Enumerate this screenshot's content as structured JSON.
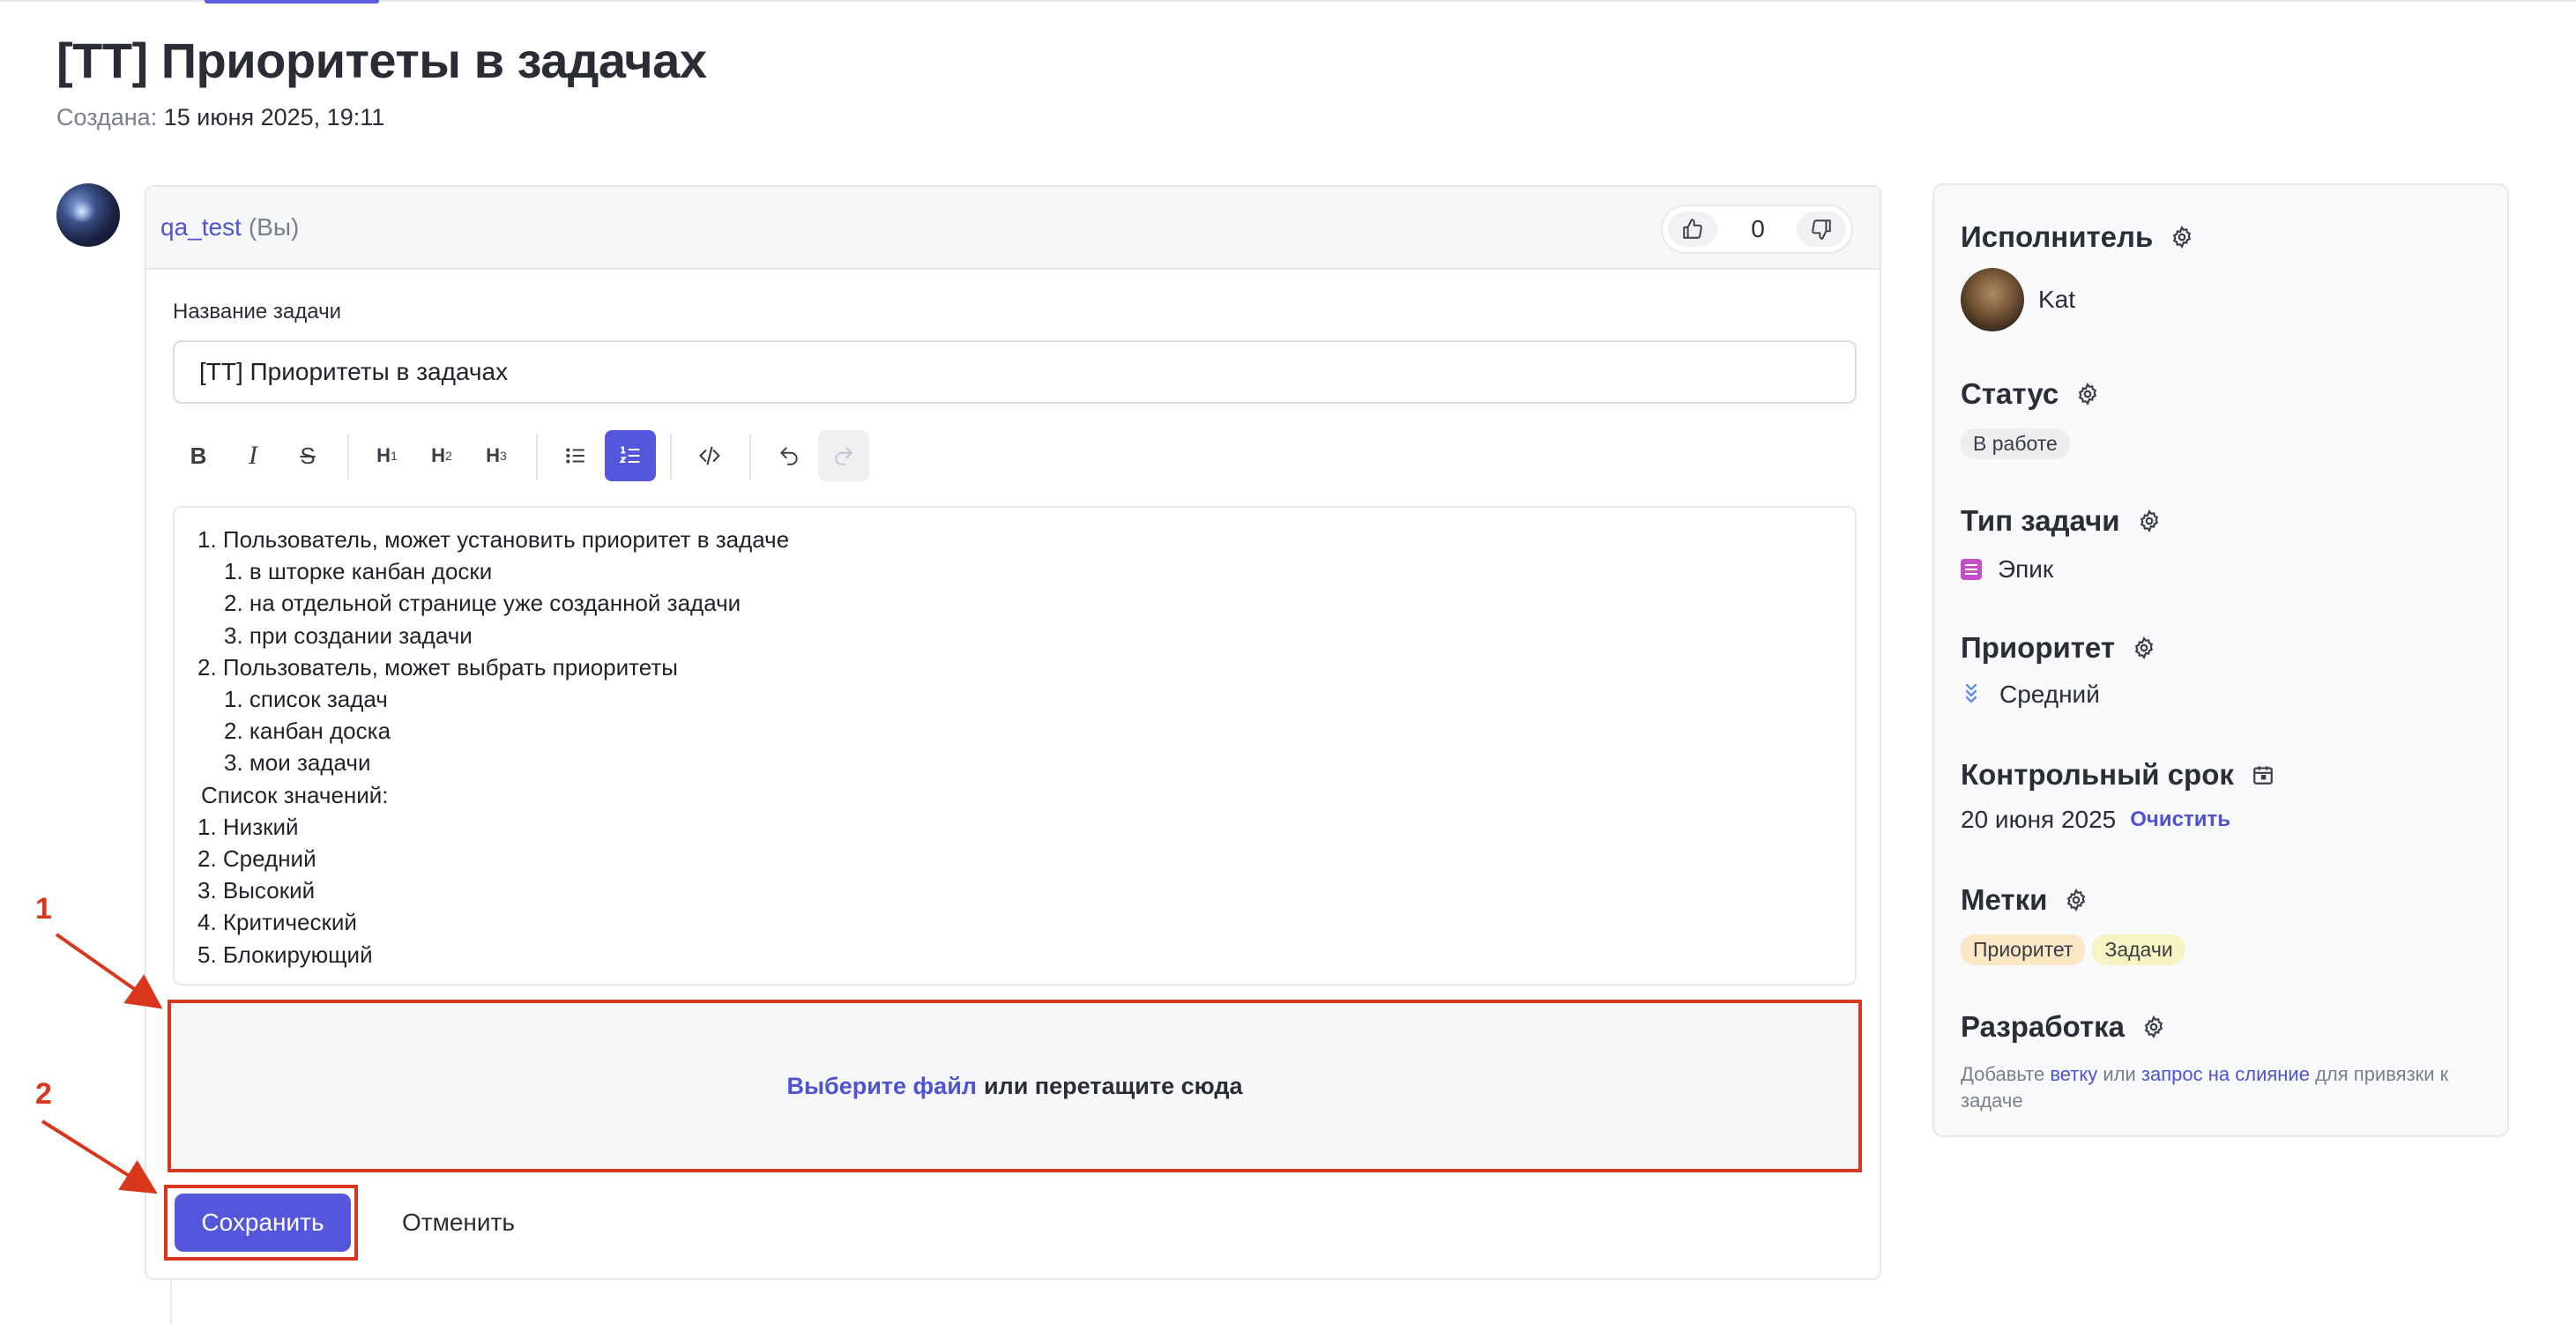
{
  "page": {
    "title": "[TT] Приоритеты в задачах",
    "created_label": "Создана:",
    "created_value": "15 июня 2025, 19:11"
  },
  "comment": {
    "author": "qa_test",
    "author_suffix": "(Вы)",
    "votes": 0
  },
  "form": {
    "title_label": "Название задачи",
    "title_value": "[TT] Приоритеты в задачах",
    "toolbar": {
      "bold": "B",
      "italic": "I",
      "strike": "S",
      "h1": "H",
      "h2": "H",
      "h3": "H",
      "h1_sub": "1",
      "h2_sub": "2",
      "h3_sub": "3",
      "active_tool": "ordered-list",
      "redo_disabled": true
    },
    "description": [
      "1. Пользователь, может установить приоритет в задаче",
      "1. в шторке канбан доски",
      "2. на отдельной странице уже созданной задачи",
      "3. при создании задачи",
      "2. Пользователь, может выбрать приоритеты",
      "1. список задач",
      "2. канбан доска",
      "3. мои задачи",
      "Список значений:",
      "1. Низкий",
      "2. Средний",
      "3. Высокий",
      "4. Критический",
      "5. Блокирующий"
    ],
    "dropzone_link": "Выберите файл",
    "dropzone_text": "или перетащите сюда",
    "save_label": "Сохранить",
    "cancel_label": "Отменить"
  },
  "annotations": {
    "one": "1",
    "two": "2",
    "color": "#d8371e"
  },
  "sidebar": {
    "assignee_label": "Исполнитель",
    "assignee_name": "Kat",
    "status_label": "Статус",
    "status_value": "В работе",
    "type_label": "Тип задачи",
    "type_value": "Эпик",
    "priority_label": "Приоритет",
    "priority_value": "Средний",
    "deadline_label": "Контрольный срок",
    "deadline_value": "20 июня 2025",
    "deadline_clear": "Очистить",
    "tags_label": "Метки",
    "tags": [
      "Приоритет",
      "Задачи"
    ],
    "dev_label": "Разработка",
    "dev_text_1": "Добавьте",
    "dev_link_1": "ветку",
    "dev_text_2": "или",
    "dev_link_2": "запрос на слияние",
    "dev_text_3": "для привязки к задаче"
  },
  "colors": {
    "accent": "#5457dc",
    "link": "#4f53cf",
    "annotation": "#d8371e"
  }
}
